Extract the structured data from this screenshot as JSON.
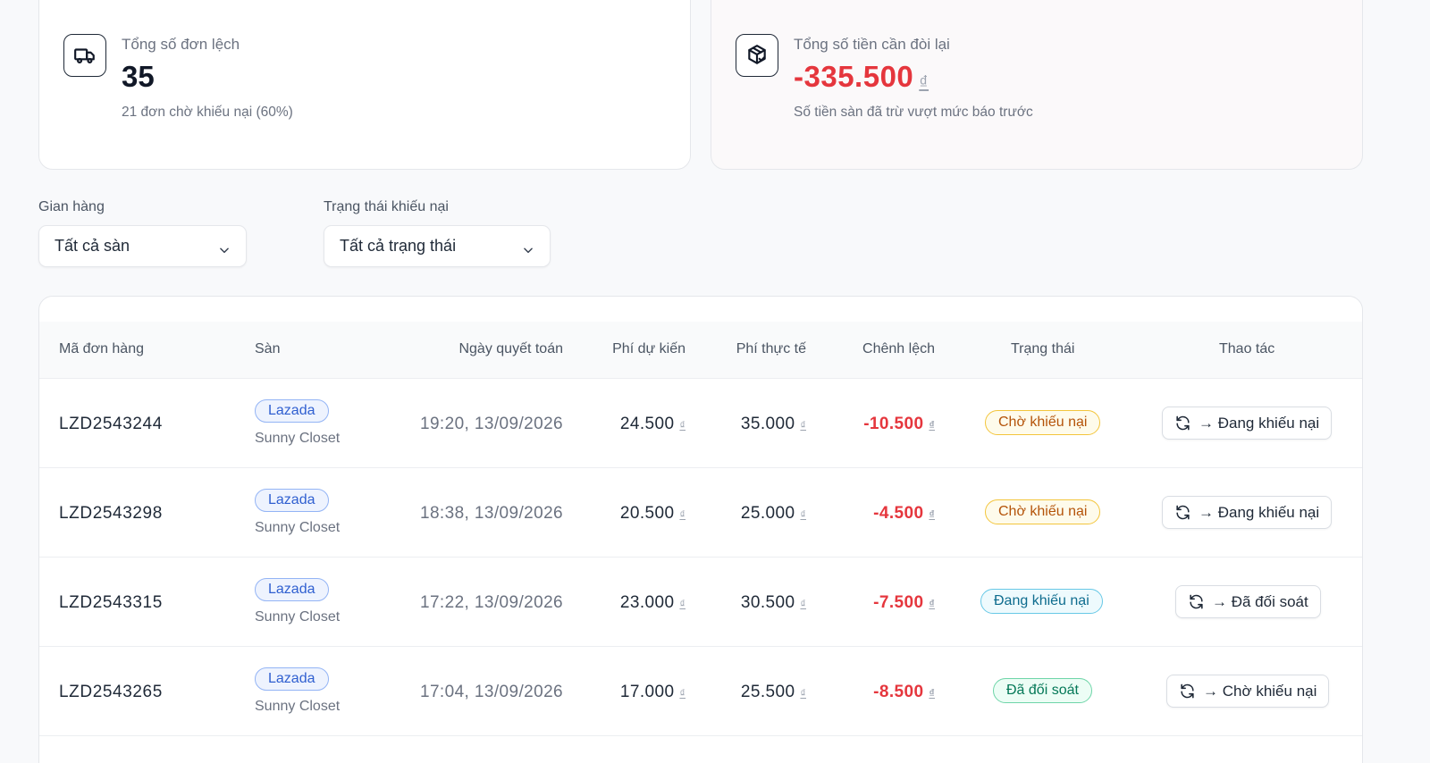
{
  "summary": {
    "mismatch": {
      "label": "Tổng số đơn lệch",
      "value": "35",
      "sub": "21 đơn chờ khiếu nại (60%)",
      "icon": "truck-icon"
    },
    "refund": {
      "label": "Tổng số tiền cần đòi lại",
      "value": "-335.500",
      "currency": "₫",
      "sub": "Số tiền sàn đã trừ vượt mức báo trước",
      "icon": "package-check-icon",
      "color": "#e5363d"
    }
  },
  "filters": {
    "shop": {
      "label": "Gian hàng",
      "value": "Tất cả sàn"
    },
    "status": {
      "label": "Trạng thái khiếu nại",
      "value": "Tất cả trạng thái"
    }
  },
  "table": {
    "columns": {
      "order_id": "Mã đơn hàng",
      "platform": "Sàn",
      "date": "Ngày quyết toán",
      "fee_expected": "Phí dự kiến",
      "fee_actual": "Phí thực tế",
      "diff": "Chênh lệch",
      "status": "Trạng thái",
      "action": "Thao tác"
    },
    "currency": "₫",
    "rows": [
      {
        "order_id": "LZD2543244",
        "platform": "Lazada",
        "shop": "Sunny Closet",
        "date": "19:20, 13/09/2026",
        "fee_expected": "24.500",
        "fee_actual": "35.000",
        "diff": "-10.500",
        "status": "Chờ khiếu nại",
        "status_type": "pending",
        "action": "→ Đang khiếu nại"
      },
      {
        "order_id": "LZD2543298",
        "platform": "Lazada",
        "shop": "Sunny Closet",
        "date": "18:38, 13/09/2026",
        "fee_expected": "20.500",
        "fee_actual": "25.000",
        "diff": "-4.500",
        "status": "Chờ khiếu nại",
        "status_type": "pending",
        "action": "→ Đang khiếu nại"
      },
      {
        "order_id": "LZD2543315",
        "platform": "Lazada",
        "shop": "Sunny Closet",
        "date": "17:22, 13/09/2026",
        "fee_expected": "23.000",
        "fee_actual": "30.500",
        "diff": "-7.500",
        "status": "Đang khiếu nại",
        "status_type": "progress",
        "action": "→ Đã đối soát"
      },
      {
        "order_id": "LZD2543265",
        "platform": "Lazada",
        "shop": "Sunny Closet",
        "date": "17:04, 13/09/2026",
        "fee_expected": "17.000",
        "fee_actual": "25.500",
        "diff": "-8.500",
        "status": "Đã đối soát",
        "status_type": "done",
        "action": "→ Chờ khiếu nại"
      }
    ]
  }
}
